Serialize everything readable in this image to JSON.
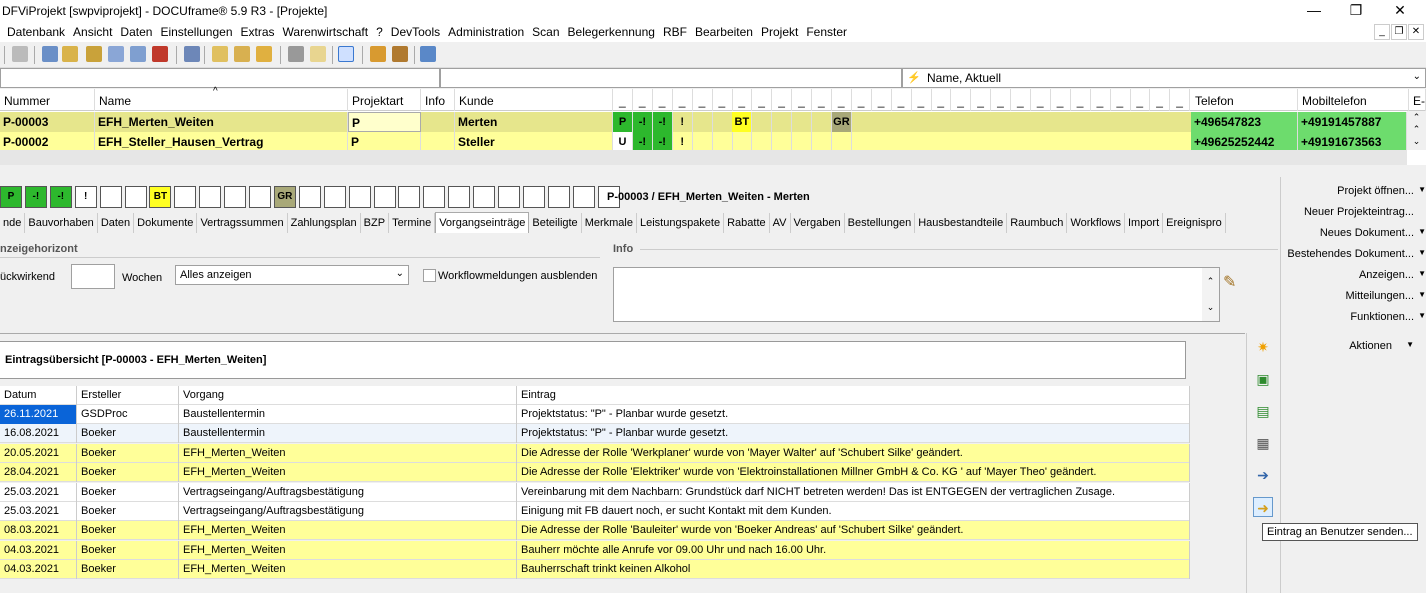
{
  "window": {
    "title": "DFViProjekt [swpviprojekt] - DOCUframe® 5.9 R3 - [Projekte]",
    "minimize": "—",
    "maximize": "❐",
    "close": "✕"
  },
  "menu": [
    "Datenbank",
    "Ansicht",
    "Daten",
    "Einstellungen",
    "Extras",
    "Warenwirtschaft",
    "?",
    "DevTools",
    "Administration",
    "Scan",
    "Belegerkennung",
    "RBF",
    "Bearbeiten",
    "Projekt",
    "Fenster"
  ],
  "filter": {
    "view": "Name, Aktuell"
  },
  "projects": {
    "headers": {
      "nummer": "Nummer",
      "name": "Name",
      "projektart": "Projektart",
      "info": "Info",
      "kunde": "Kunde",
      "telefon": "Telefon",
      "mobil": "Mobiltelefon",
      "e": "E-"
    },
    "flag_headers": "_",
    "rows": [
      {
        "nummer": "P-00003",
        "name": "EFH_Merten_Weiten",
        "projektart": "P",
        "kunde": "Merten",
        "flags": [
          "P",
          "-!",
          "-!",
          "!",
          "",
          "",
          "BT",
          "",
          "",
          "",
          "",
          "GR"
        ],
        "telefon": "+496547823",
        "mobil": "+49191457887"
      },
      {
        "nummer": "P-00002",
        "name": "EFH_Steller_Hausen_Vertrag",
        "projektart": "P",
        "kunde": "Steller",
        "flags": [
          "U",
          "-!",
          "-!",
          "!",
          "",
          "",
          "",
          "",
          "",
          "",
          "",
          ""
        ],
        "telefon": "+49625252442",
        "mobil": "+49191673563"
      }
    ]
  },
  "detail": {
    "status_boxes": [
      "P",
      "-!",
      "-!",
      "!",
      "",
      "",
      "BT",
      "",
      "",
      "",
      "",
      "GR",
      "",
      "",
      "",
      "",
      "",
      "",
      "",
      "",
      "",
      "",
      "",
      "",
      ""
    ],
    "heading": "P-00003 / EFH_Merten_Weiten - Merten",
    "tabs": [
      "nde",
      "Bauvorhaben",
      "Daten",
      "Dokumente",
      "Vertragssummen",
      "Zahlungsplan",
      "BZP",
      "Termine",
      "Vorgangseinträge",
      "Beteiligte",
      "Merkmale",
      "Leistungspakete",
      "Rabatte",
      "AV",
      "Vergaben",
      "Bestellungen",
      "Hausbestandteile",
      "Raumbuch",
      "Workflows",
      "Import",
      "Ereignispro"
    ],
    "active_tab": "Vorgangseinträge",
    "horizon_label": "nzeigehorizont",
    "info_label": "Info",
    "rueckwirkend": "ückwirkend",
    "wochen": "Wochen",
    "wochen_value": "",
    "show_select": "Alles anzeigen",
    "wf_checkbox": "Workflowmeldungen ausblenden",
    "overview_title": "Eintragsübersicht [P-00003 - EFH_Merten_Weiten]"
  },
  "entries": {
    "headers": {
      "datum": "Datum",
      "ersteller": "Ersteller",
      "vorgang": "Vorgang",
      "eintrag": "Eintrag"
    },
    "rows": [
      {
        "datum": "26.11.2021",
        "ersteller": "GSDProc",
        "vorgang": "Baustellentermin",
        "eintrag": "Projektstatus: \"P\" - Planbar wurde gesetzt.",
        "style": "sel"
      },
      {
        "datum": "16.08.2021",
        "ersteller": "Boeker",
        "vorgang": "Baustellentermin",
        "eintrag": "Projektstatus: \"P\" - Planbar wurde gesetzt.",
        "style": "light"
      },
      {
        "datum": "20.05.2021",
        "ersteller": "Boeker",
        "vorgang": "EFH_Merten_Weiten",
        "eintrag": "Die Adresse der Rolle 'Werkplaner' wurde von 'Mayer Walter' auf 'Schubert Silke' geändert.",
        "style": "yellow"
      },
      {
        "datum": "28.04.2021",
        "ersteller": "Boeker",
        "vorgang": "EFH_Merten_Weiten",
        "eintrag": "Die Adresse der Rolle 'Elektriker' wurde von 'Elektroinstallationen Millner GmbH & Co. KG ' auf 'Mayer Theo' geändert.",
        "style": "yellow"
      },
      {
        "datum": "25.03.2021",
        "ersteller": "Boeker",
        "vorgang": "Vertragseingang/Auftragsbestätigung",
        "eintrag": "Vereinbarung mit dem Nachbarn: Grundstück  darf NICHT betreten werden! Das ist ENTGEGEN der vertraglichen Zusage.",
        "style": "white"
      },
      {
        "datum": "25.03.2021",
        "ersteller": "Boeker",
        "vorgang": "Vertragseingang/Auftragsbestätigung",
        "eintrag": "Einigung mit FB dauert noch, er sucht Kontakt mit dem Kunden.",
        "style": "white"
      },
      {
        "datum": "08.03.2021",
        "ersteller": "Boeker",
        "vorgang": "EFH_Merten_Weiten",
        "eintrag": "Die Adresse der Rolle 'Bauleiter' wurde von 'Boeker Andreas' auf 'Schubert Silke' geändert.",
        "style": "yellow"
      },
      {
        "datum": "04.03.2021",
        "ersteller": "Boeker",
        "vorgang": "EFH_Merten_Weiten",
        "eintrag": "Bauherr möchte alle Anrufe vor 09.00 Uhr und nach 16.00 Uhr.",
        "style": "yellow"
      },
      {
        "datum": "04.03.2021",
        "ersteller": "Boeker",
        "vorgang": "EFH_Merten_Weiten",
        "eintrag": "Bauherrschaft trinkt keinen Alkohol",
        "style": "yellow"
      }
    ]
  },
  "right_panel": [
    "Projekt öffnen...",
    "Neuer Projekteintrag...",
    "Neues Dokument...",
    "Bestehendes Dokument...",
    "Anzeigen...",
    "Mitteilungen...",
    "Funktionen...",
    "Aktionen"
  ],
  "tooltip": "Eintrag an Benutzer senden..."
}
